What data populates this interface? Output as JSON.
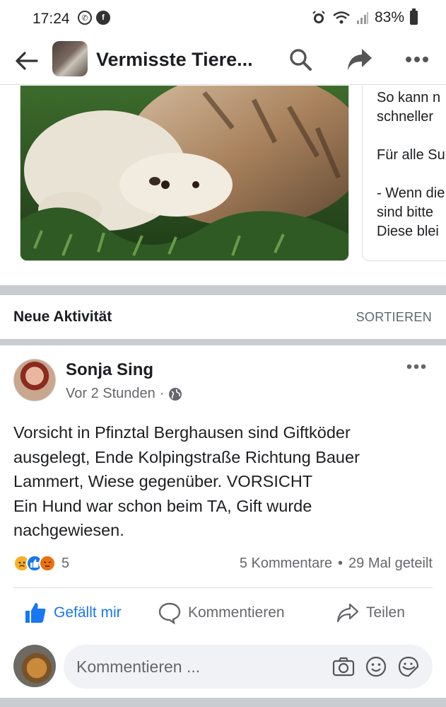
{
  "status_bar": {
    "time": "17:24",
    "battery": "83%",
    "left_icons": [
      "whatsapp-icon",
      "facebook-icon"
    ],
    "right_icons": [
      "alarm-icon",
      "wifi-icon",
      "signal-icon",
      "battery-icon"
    ]
  },
  "header": {
    "title": "Vermisste Tiere...",
    "icons": [
      "back-arrow-icon",
      "search-icon",
      "share-icon",
      "more-icon"
    ]
  },
  "pinned": {
    "text_lines": [
      "So kann n",
      "schneller",
      "",
      "Für alle Su",
      "",
      "- Wenn die",
      "sind bitte",
      "Diese blei"
    ]
  },
  "activity": {
    "title": "Neue Aktivität",
    "sort_label": "SORTIEREN"
  },
  "post": {
    "author": "Sonja Sing",
    "time": "Vor 2 Stunden",
    "separator": "·",
    "text_lines": [
      "Vorsicht in Pfinztal Berghausen sind Giftköder",
      "ausgelegt, Ende Kolpingstraße Richtung Bauer",
      "Lammert, Wiese gegenüber. VORSICHT",
      "Ein Hund war schon beim TA, Gift wurde",
      "nachgewiesen."
    ],
    "reaction_count": "5",
    "comments": "5 Kommentare",
    "dot": "•",
    "shares": "29 Mal geteilt",
    "actions": {
      "like": "Gefällt mir",
      "comment": "Kommentieren",
      "share": "Teilen"
    },
    "comment_placeholder": "Kommentieren ..."
  },
  "colors": {
    "accent": "#1877f2",
    "separator": "#c9ccd1",
    "muted_text": "#65676b",
    "input_bg": "#f0f2f5"
  }
}
